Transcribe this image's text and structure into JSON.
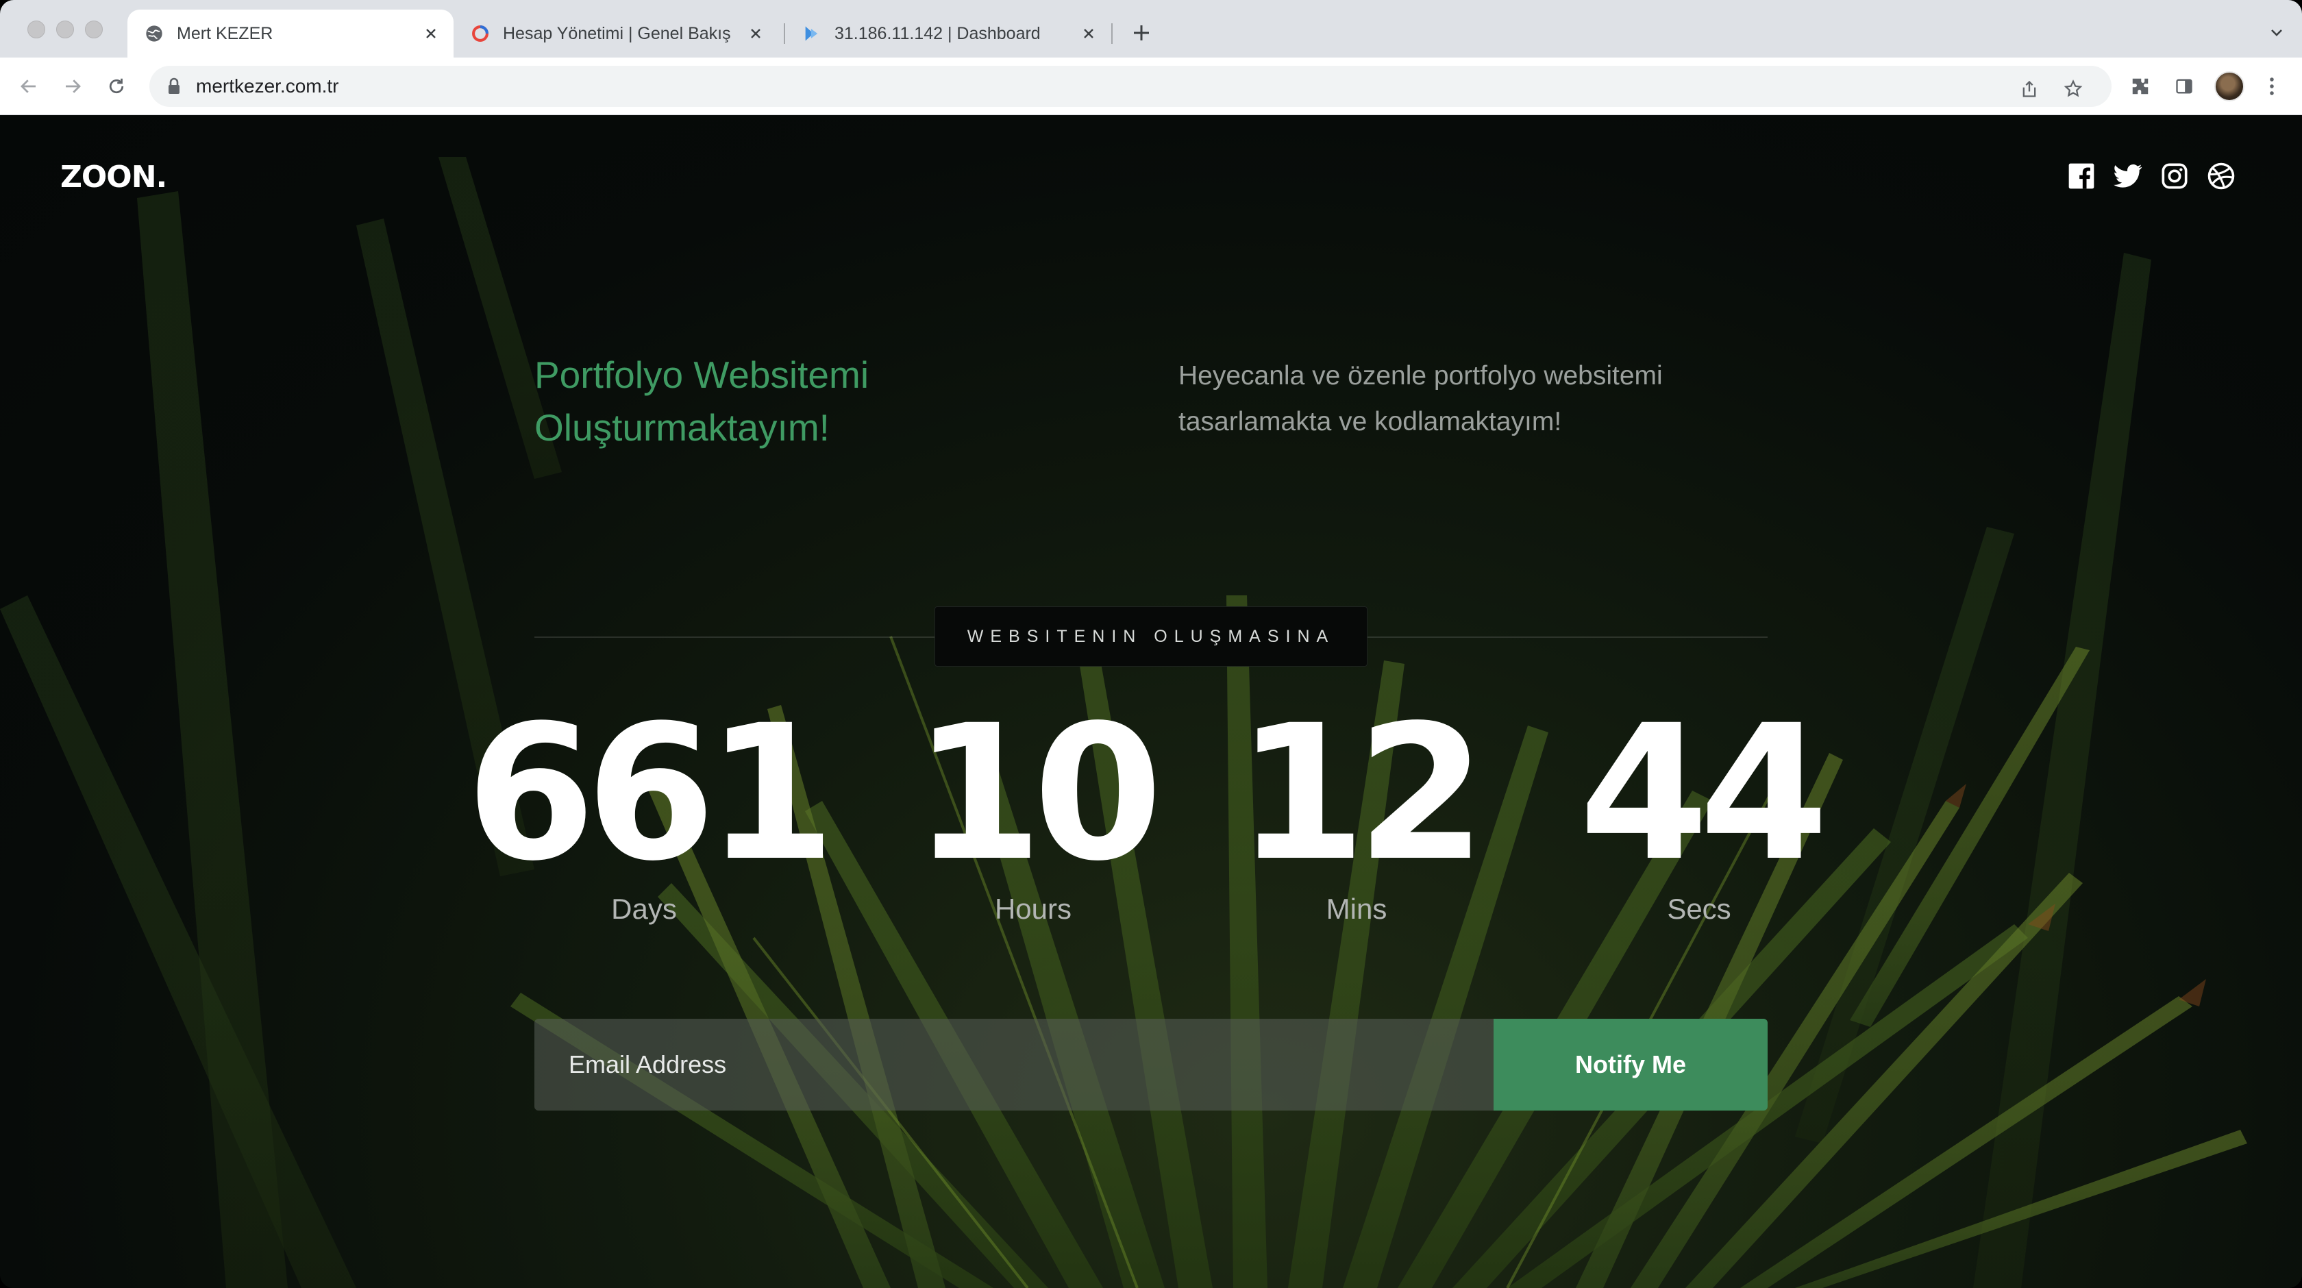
{
  "browser": {
    "tabs": [
      {
        "title": "Mert KEZER",
        "favicon": "globe-icon",
        "active": true
      },
      {
        "title": "Hesap Yönetimi | Genel Bakış",
        "favicon": "ring-logo-icon",
        "active": false
      },
      {
        "title": "31.186.11.142 | Dashboard",
        "favicon": "chevron-logo-icon",
        "active": false
      }
    ],
    "url": "mertkezer.com.tr"
  },
  "site": {
    "logo": "ZOON.",
    "social": [
      "facebook-icon",
      "twitter-icon",
      "instagram-icon",
      "dribbble-icon"
    ],
    "headline": "Portfolyo Websitemi Oluşturmaktayım!",
    "subtext": "Heyecanla ve özenle portfolyo websitemi tasarlamakta ve kodlamaktayım!",
    "countdown_label": "WEBSITENIN OLUŞMASINA",
    "countdown": [
      {
        "value": "661",
        "label": "Days"
      },
      {
        "value": "10",
        "label": "Hours"
      },
      {
        "value": "12",
        "label": "Mins"
      },
      {
        "value": "44",
        "label": "Secs"
      }
    ],
    "email_placeholder": "Email Address",
    "notify_label": "Notify Me"
  },
  "colors": {
    "accent_green": "#3f9b63",
    "button_green": "#3d8c5c",
    "page_bg": "#070b09"
  }
}
